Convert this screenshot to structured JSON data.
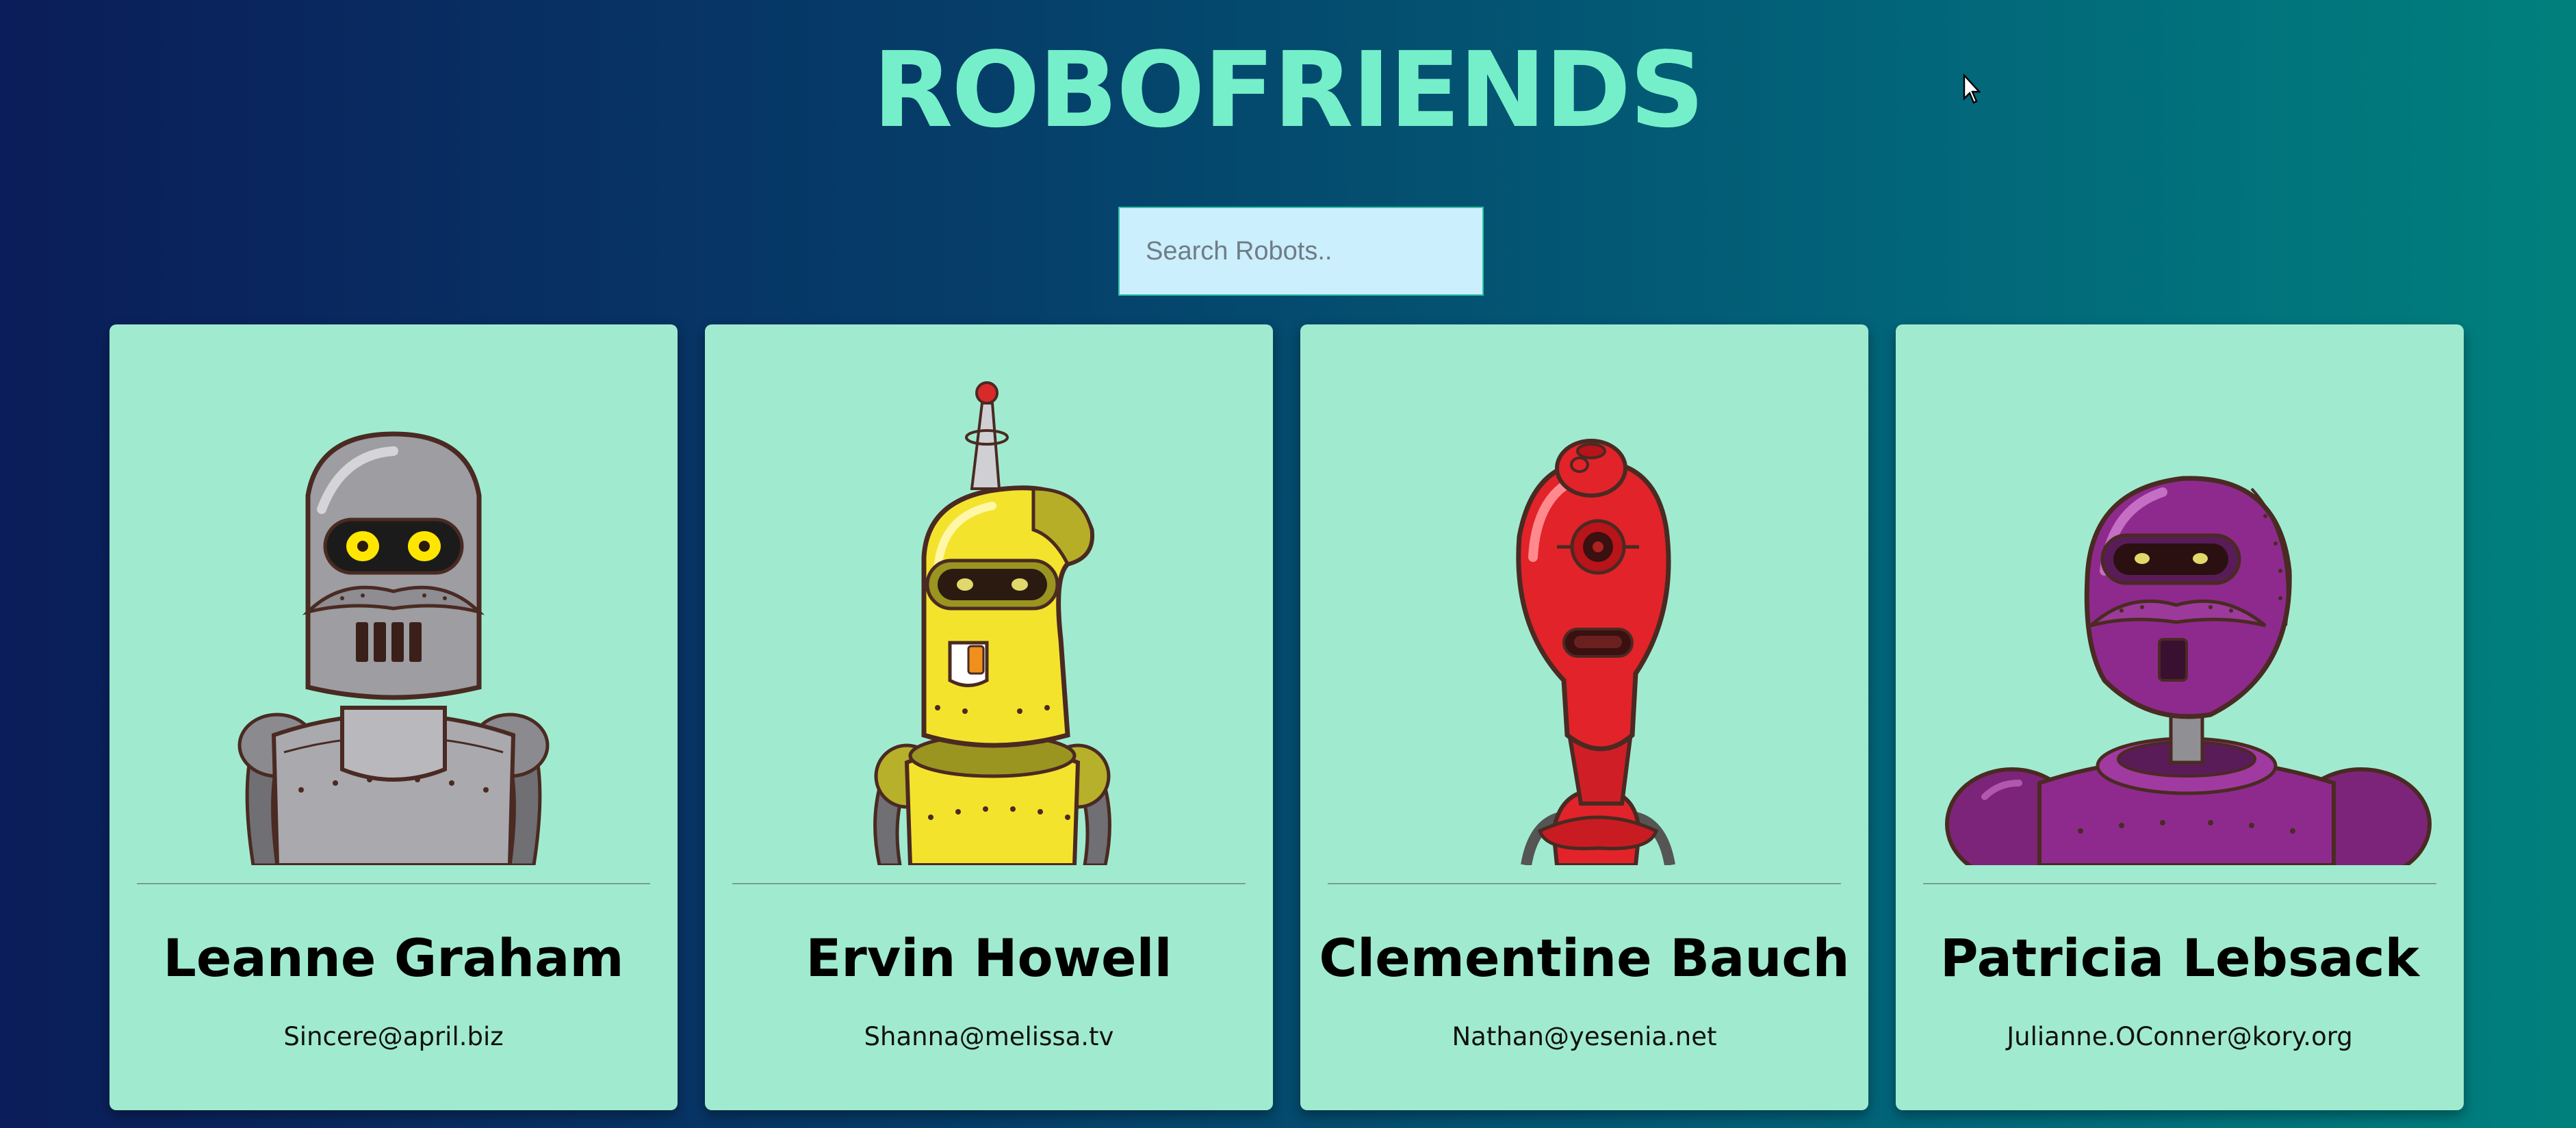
{
  "app": {
    "title": "ROBOFRIENDS"
  },
  "search": {
    "placeholder": "Search Robots.."
  },
  "robots": [
    {
      "name": "Leanne Graham",
      "email": "Sincere@april.biz",
      "color": "#9a9a9f",
      "icon": "gray-robot-avatar"
    },
    {
      "name": "Ervin Howell",
      "email": "Shanna@melissa.tv",
      "color": "#f5e030",
      "icon": "yellow-robot-avatar"
    },
    {
      "name": "Clementine Bauch",
      "email": "Nathan@yesenia.net",
      "color": "#e2232a",
      "icon": "red-robot-avatar"
    },
    {
      "name": "Patricia Lebsack",
      "email": "Julianne.OConner@kory.org",
      "color": "#8e2a8e",
      "icon": "purple-robot-avatar"
    }
  ],
  "colors": {
    "title": "#75efc9",
    "card_background": "#a0ebd0",
    "search_background": "#cbeffc"
  }
}
